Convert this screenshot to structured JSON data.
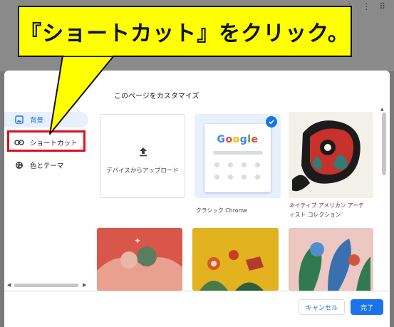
{
  "callout": {
    "text": "『ショートカット』をクリック。"
  },
  "dialog": {
    "title": "このページをカスタマイズ"
  },
  "sidebar": {
    "items": [
      {
        "label": "背景",
        "icon": "image-icon",
        "selected": true
      },
      {
        "label": "ショートカット",
        "icon": "link-icon",
        "selected": false
      },
      {
        "label": "色とテーマ",
        "icon": "palette-icon",
        "selected": false
      }
    ]
  },
  "tiles": {
    "upload_label": "デバイスからアップロード",
    "classic_caption": "クラシック Chrome",
    "classic_logo": "Google",
    "art_caption_line1": "ネイティブ アメリカン アーテ",
    "art_caption_line2": "ィスト コレクション"
  },
  "footer": {
    "cancel_label": "キャンセル",
    "done_label": "完了"
  },
  "colors": {
    "accent": "#1a73e8",
    "highlight": "#e0101e",
    "callout_bg": "#ffff00"
  }
}
